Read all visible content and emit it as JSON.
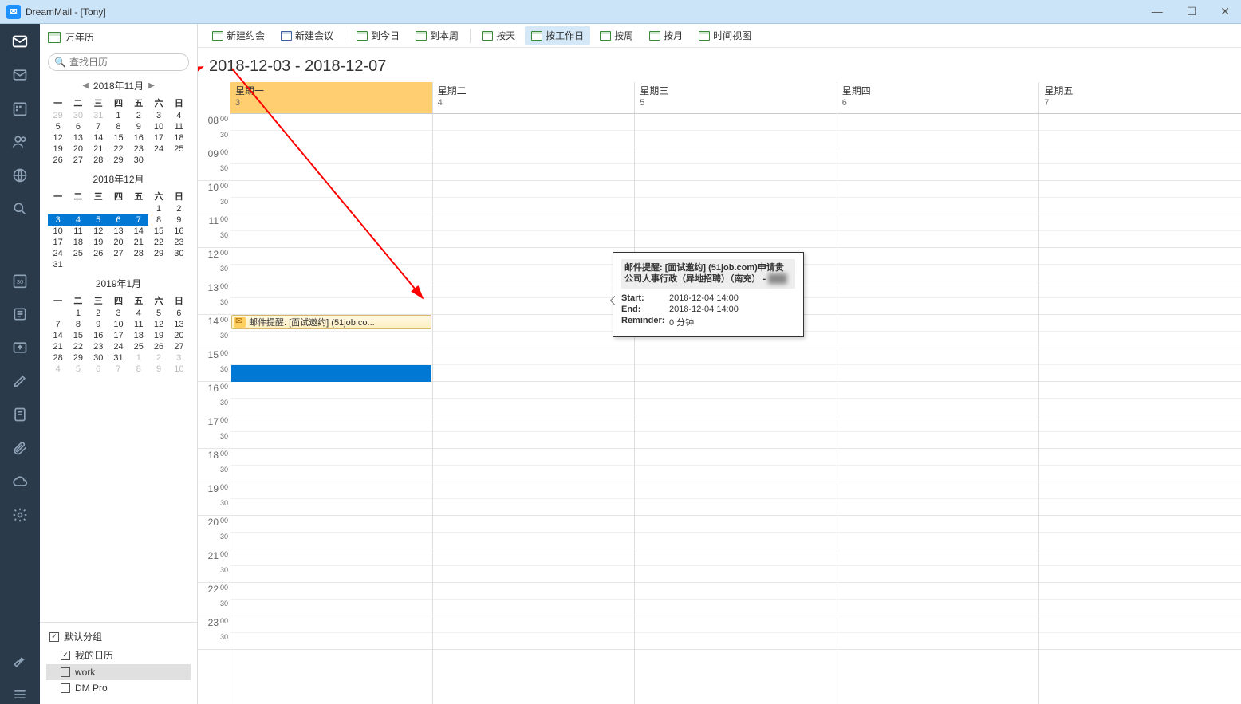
{
  "window": {
    "title": "DreamMail - [Tony]"
  },
  "sidebar": {
    "head": "万年历",
    "search_placeholder": "查找日历",
    "months": [
      {
        "title": "2018年11月",
        "dow": [
          "一",
          "二",
          "三",
          "四",
          "五",
          "六",
          "日"
        ],
        "weeks": [
          [
            "29",
            "30",
            "31",
            "1",
            "2",
            "3",
            "4"
          ],
          [
            "5",
            "6",
            "7",
            "8",
            "9",
            "10",
            "11"
          ],
          [
            "12",
            "13",
            "14",
            "15",
            "16",
            "17",
            "18"
          ],
          [
            "19",
            "20",
            "21",
            "22",
            "23",
            "24",
            "25"
          ],
          [
            "26",
            "27",
            "28",
            "29",
            "30",
            "",
            ""
          ]
        ],
        "dim_cells": [
          [
            0,
            0
          ],
          [
            0,
            1
          ],
          [
            0,
            2
          ]
        ]
      },
      {
        "title": "2018年12月",
        "dow": [
          "一",
          "二",
          "三",
          "四",
          "五",
          "六",
          "日"
        ],
        "weeks": [
          [
            "",
            "",
            "",
            "",
            "",
            "1",
            "2"
          ],
          [
            "3",
            "4",
            "5",
            "6",
            "7",
            "8",
            "9"
          ],
          [
            "10",
            "11",
            "12",
            "13",
            "14",
            "15",
            "16"
          ],
          [
            "17",
            "18",
            "19",
            "20",
            "21",
            "22",
            "23"
          ],
          [
            "24",
            "25",
            "26",
            "27",
            "28",
            "29",
            "30"
          ],
          [
            "31",
            "",
            "",
            "",
            "",
            "",
            ""
          ]
        ],
        "hl_cells": [
          [
            1,
            0
          ],
          [
            1,
            1
          ],
          [
            1,
            2
          ],
          [
            1,
            3
          ],
          [
            1,
            4
          ]
        ]
      },
      {
        "title": "2019年1月",
        "dow": [
          "一",
          "二",
          "三",
          "四",
          "五",
          "六",
          "日"
        ],
        "weeks": [
          [
            "",
            "1",
            "2",
            "3",
            "4",
            "5",
            "6"
          ],
          [
            "7",
            "8",
            "9",
            "10",
            "11",
            "12",
            "13"
          ],
          [
            "14",
            "15",
            "16",
            "17",
            "18",
            "19",
            "20"
          ],
          [
            "21",
            "22",
            "23",
            "24",
            "25",
            "26",
            "27"
          ],
          [
            "28",
            "29",
            "30",
            "31",
            "1",
            "2",
            "3"
          ],
          [
            "4",
            "5",
            "6",
            "7",
            "8",
            "9",
            "10"
          ]
        ],
        "dim_cells": [
          [
            4,
            4
          ],
          [
            4,
            5
          ],
          [
            4,
            6
          ],
          [
            5,
            0
          ],
          [
            5,
            1
          ],
          [
            5,
            2
          ],
          [
            5,
            3
          ],
          [
            5,
            4
          ],
          [
            5,
            5
          ],
          [
            5,
            6
          ]
        ]
      }
    ],
    "groups": {
      "default": "默认分组",
      "mycal": "我的日历",
      "work": "work",
      "dmpro": "DM Pro"
    }
  },
  "toolbar": {
    "new_appt": "新建约会",
    "new_meeting": "新建会议",
    "today": "到今日",
    "this_week": "到本周",
    "by_day": "按天",
    "by_workweek": "按工作日",
    "by_week": "按周",
    "by_month": "按月",
    "timeline": "时间视图"
  },
  "range": "2018-12-03 - 2018-12-07",
  "week": {
    "days": [
      {
        "label": "星期一",
        "num": "3",
        "today": true
      },
      {
        "label": "星期二",
        "num": "4",
        "today": false
      },
      {
        "label": "星期三",
        "num": "5",
        "today": false
      },
      {
        "label": "星期四",
        "num": "6",
        "today": false
      },
      {
        "label": "星期五",
        "num": "7",
        "today": false
      }
    ],
    "hours": [
      "08",
      "09",
      "10",
      "11",
      "12",
      "13",
      "14",
      "15",
      "16",
      "17",
      "18",
      "19",
      "20",
      "21",
      "22",
      "23"
    ],
    "min_labels": {
      "top": "00",
      "bot": "30"
    }
  },
  "event": {
    "label": "邮件提醒: [面试邀约] (51job.co..."
  },
  "tooltip": {
    "title": "邮件提醒: [面试邀约] (51job.com)申请贵公司人事行政（异地招聘）（南充） - ",
    "start_label": "Start:",
    "start_val": "2018-12-04  14:00",
    "end_label": "End:",
    "end_val": "2018-12-04  14:00",
    "rem_label": "Reminder:",
    "rem_val": "0 分钟"
  }
}
